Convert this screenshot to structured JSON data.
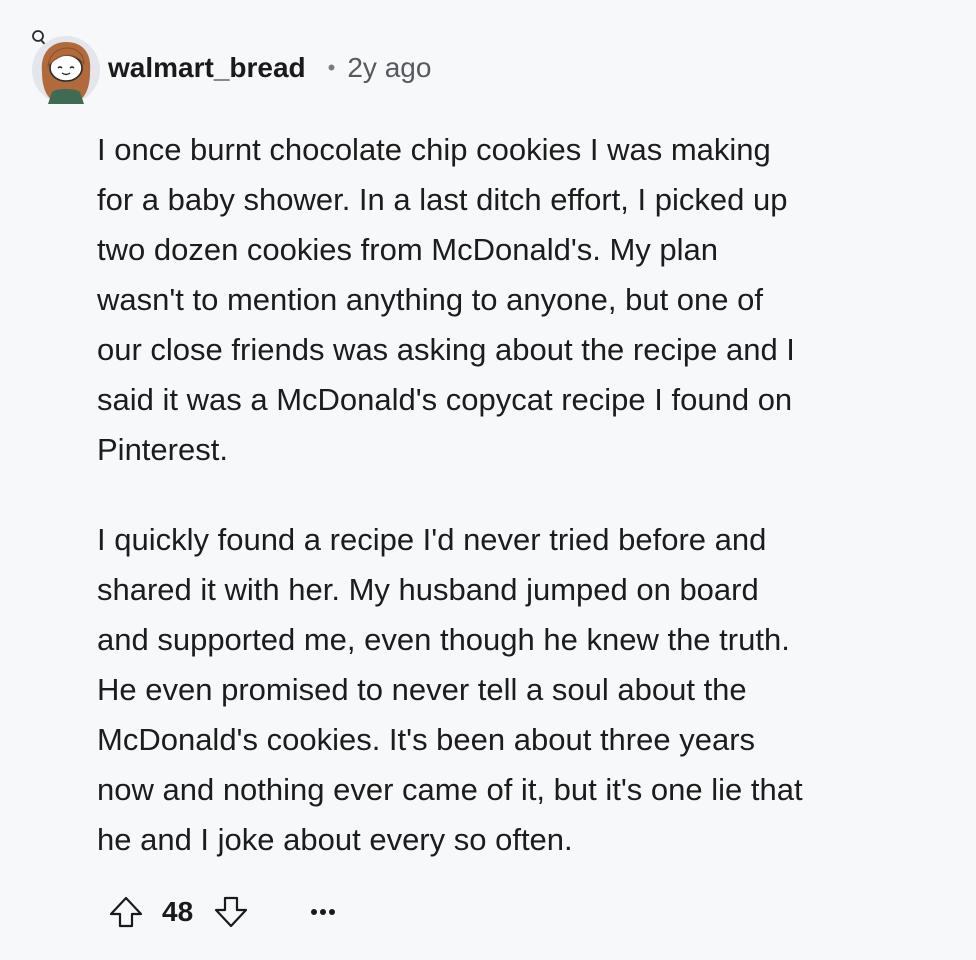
{
  "comment": {
    "author": "walmart_bread",
    "separator": "•",
    "timestamp": "2y ago",
    "paragraphs": [
      "I once burnt chocolate chip cookies I was making\nfor a baby shower. In a last ditch effort, I picked up\ntwo dozen cookies from McDonald's. My plan\nwasn't to mention anything to anyone, but one of\nour close friends was asking about the recipe and I\nsaid it was a McDonald's copycat recipe I found on\nPinterest.",
      "I quickly found a recipe I'd never tried before and\nshared it with her. My husband jumped on board\nand supported me, even though he knew the truth.\nHe even promised to never tell a soul about the\nMcDonald's cookies. It's been about three years\nnow and nothing ever came of it, but it's one lie that\nhe and I joke about every so often."
    ],
    "score": "48",
    "icons": {
      "avatar": "snoo-avatar",
      "upvote": "upvote-arrow-icon",
      "downvote": "downvote-arrow-icon",
      "more": "more-options-icon"
    }
  },
  "colors": {
    "background": "#f7f8fa",
    "text": "#1a1a1b",
    "muted": "#555a5e",
    "avatar_hair": "#b06a3c",
    "avatar_shirt": "#3f6b55"
  }
}
